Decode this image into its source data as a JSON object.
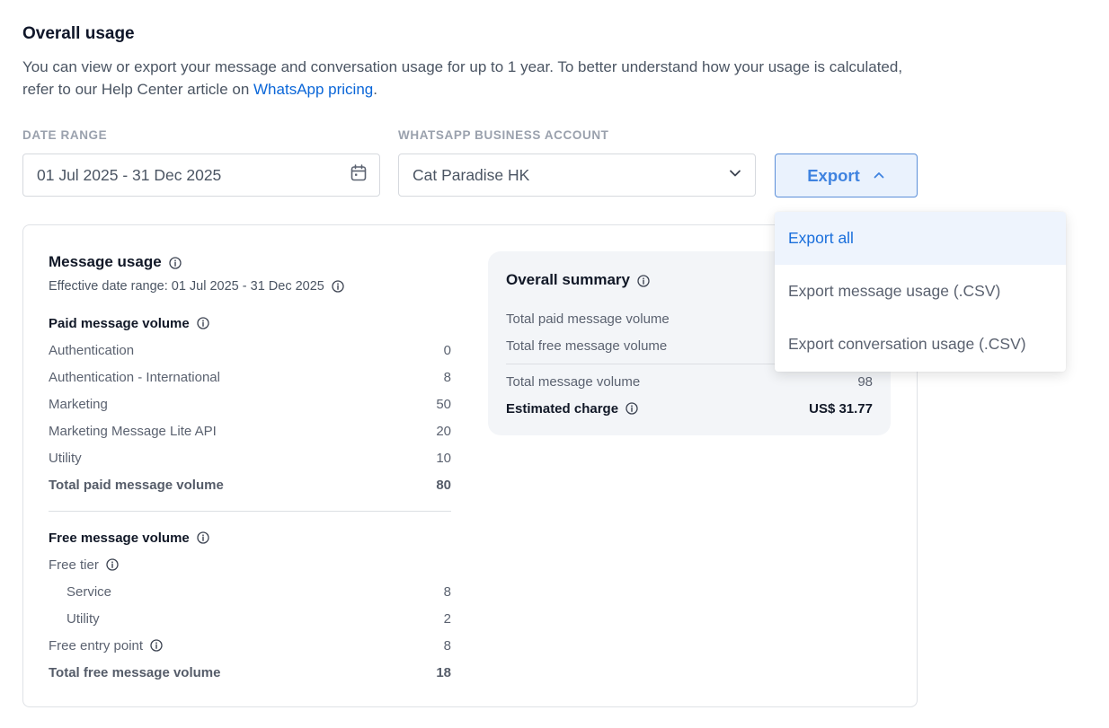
{
  "header": {
    "title": "Overall usage",
    "description_prefix": "You can view or export your message and conversation usage for up to 1 year. To better understand how your usage is calculated, refer to our Help Center article on ",
    "link_text": "WhatsApp pricing",
    "description_suffix": "."
  },
  "filters": {
    "date_range_label": "DATE RANGE",
    "date_range_value": "01 Jul 2025 - 31 Dec 2025",
    "account_label": "WHATSAPP BUSINESS ACCOUNT",
    "account_value": "Cat Paradise HK",
    "export_label": "Export"
  },
  "export_menu": {
    "items": [
      {
        "label": "Export all",
        "active": true
      },
      {
        "label": "Export message usage (.CSV)"
      },
      {
        "label": "Export conversation usage (.CSV)"
      }
    ]
  },
  "message_usage": {
    "title": "Message usage",
    "effective_range": "Effective date range: 01 Jul 2025 - 31 Dec 2025",
    "paid": {
      "title": "Paid message volume",
      "rows": [
        {
          "label": "Authentication",
          "value": "0"
        },
        {
          "label": "Authentication - International",
          "value": "8"
        },
        {
          "label": "Marketing",
          "value": "50"
        },
        {
          "label": "Marketing Message Lite API",
          "value": "20"
        },
        {
          "label": "Utility",
          "value": "10"
        }
      ],
      "total_label": "Total paid message volume",
      "total_value": "80"
    },
    "free": {
      "title": "Free message volume",
      "free_tier_label": "Free tier",
      "free_tier_rows": [
        {
          "label": "Service",
          "value": "8"
        },
        {
          "label": "Utility",
          "value": "2"
        }
      ],
      "entry_point_label": "Free entry point",
      "entry_point_value": "8",
      "total_label": "Total free message volume",
      "total_value": "18"
    }
  },
  "summary": {
    "title": "Overall summary",
    "paid_label": "Total paid message volume",
    "free_label": "Total free message volume",
    "total_label": "Total message volume",
    "total_value": "98",
    "charge_label": "Estimated charge",
    "charge_value": "US$ 31.77"
  }
}
